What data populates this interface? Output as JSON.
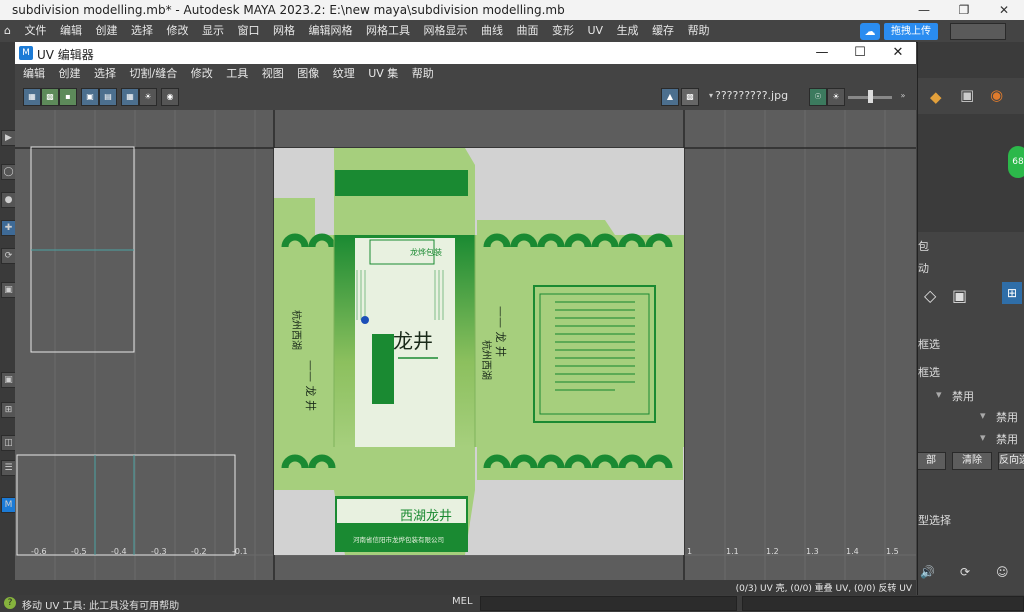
{
  "maya": {
    "title": "subdivision modelling.mb* - Autodesk MAYA 2023.2: E:\\new maya\\subdivision modelling.mb",
    "menu": [
      "文件",
      "编辑",
      "创建",
      "选择",
      "修改",
      "显示",
      "窗口",
      "网格",
      "编辑网格",
      "网格工具",
      "网格显示",
      "曲线",
      "曲面",
      "变形",
      "UV",
      "生成",
      "缓存",
      "帮助"
    ],
    "upload_label": "拖拽上传",
    "status_text": "移动 UV 工具: 此工具没有可用帮助",
    "mel_label": "MEL"
  },
  "uv_editor": {
    "title": "UV 编辑器",
    "menu": [
      "编辑",
      "创建",
      "选择",
      "切割/缝合",
      "修改",
      "工具",
      "视图",
      "图像",
      "纹理",
      "UV 集",
      "帮助"
    ],
    "texture_name": "?????????.jpg",
    "status": "(0/3) UV 壳, (0/0) 重叠 UV, (0/0) 反转 UV",
    "axis_labels": [
      "-0.6",
      "-0.5",
      "-0.4",
      "-0.3",
      "-0.2",
      "-0.1",
      "1",
      "1.1",
      "1.2",
      "1.3",
      "1.4",
      "1.5"
    ]
  },
  "box_art": {
    "brand_cn": "龙井",
    "brand_long": "西湖龙井",
    "side_text": "杭州西湖",
    "logo_text": "龙烨包装",
    "company": "河南省信阳市龙烨包装有限公司",
    "dash_text": "—— 龙 井",
    "colors": {
      "green_dark": "#1a8a32",
      "green_light": "#a6cf7d",
      "green_mid": "#8cc05e",
      "bg": "#d2d2d2"
    }
  },
  "right_panel": {
    "header": "包",
    "sub": "动",
    "frame_sel1": "框选",
    "frame_sel2": "框选",
    "disabled1": "禁用",
    "disabled2": "禁用",
    "disabled3": "禁用",
    "all_label": "部",
    "clear_label": "清除",
    "reverse_label": "反向选",
    "type_select": "型选择",
    "badge": "68"
  }
}
